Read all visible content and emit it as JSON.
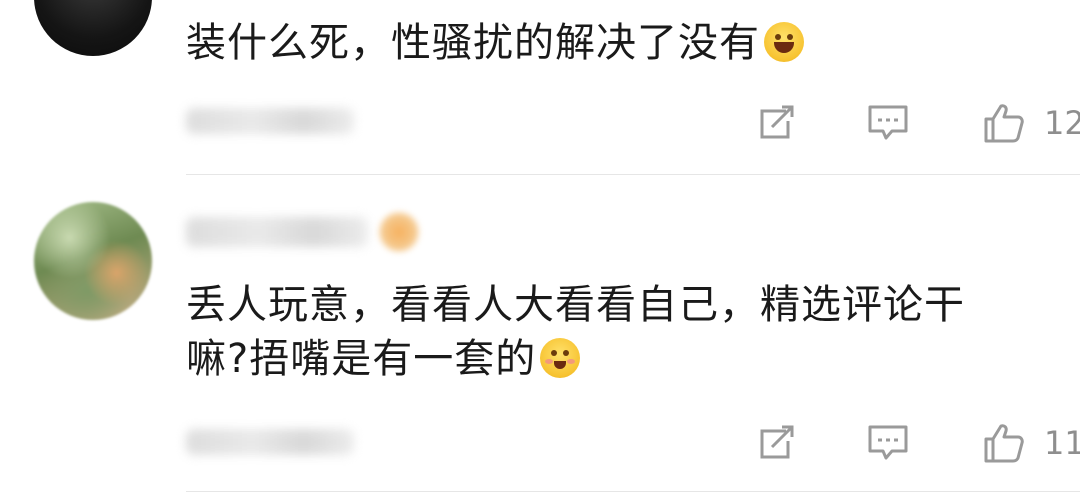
{
  "comments": [
    {
      "text": "装什么死，性骚扰的解决了没有",
      "emoji": "grinning-face-emoji",
      "likes": "12",
      "author_blurred": true,
      "time_blurred": true
    },
    {
      "text_line1": "丢人玩意，看看人大看看自己，精选评论干",
      "text_line2": "嘛?捂嘴是有一套的",
      "emoji": "blushing-face-emoji",
      "likes": "11",
      "author_blurred": true,
      "time_blurred": true
    }
  ],
  "icons": {
    "share": "share-edit-icon",
    "reply": "reply-comment-icon",
    "like": "thumbs-up-icon"
  },
  "colors": {
    "text": "#1a1a1a",
    "icon": "#9a9a9a",
    "divider": "#e6e6e6"
  }
}
